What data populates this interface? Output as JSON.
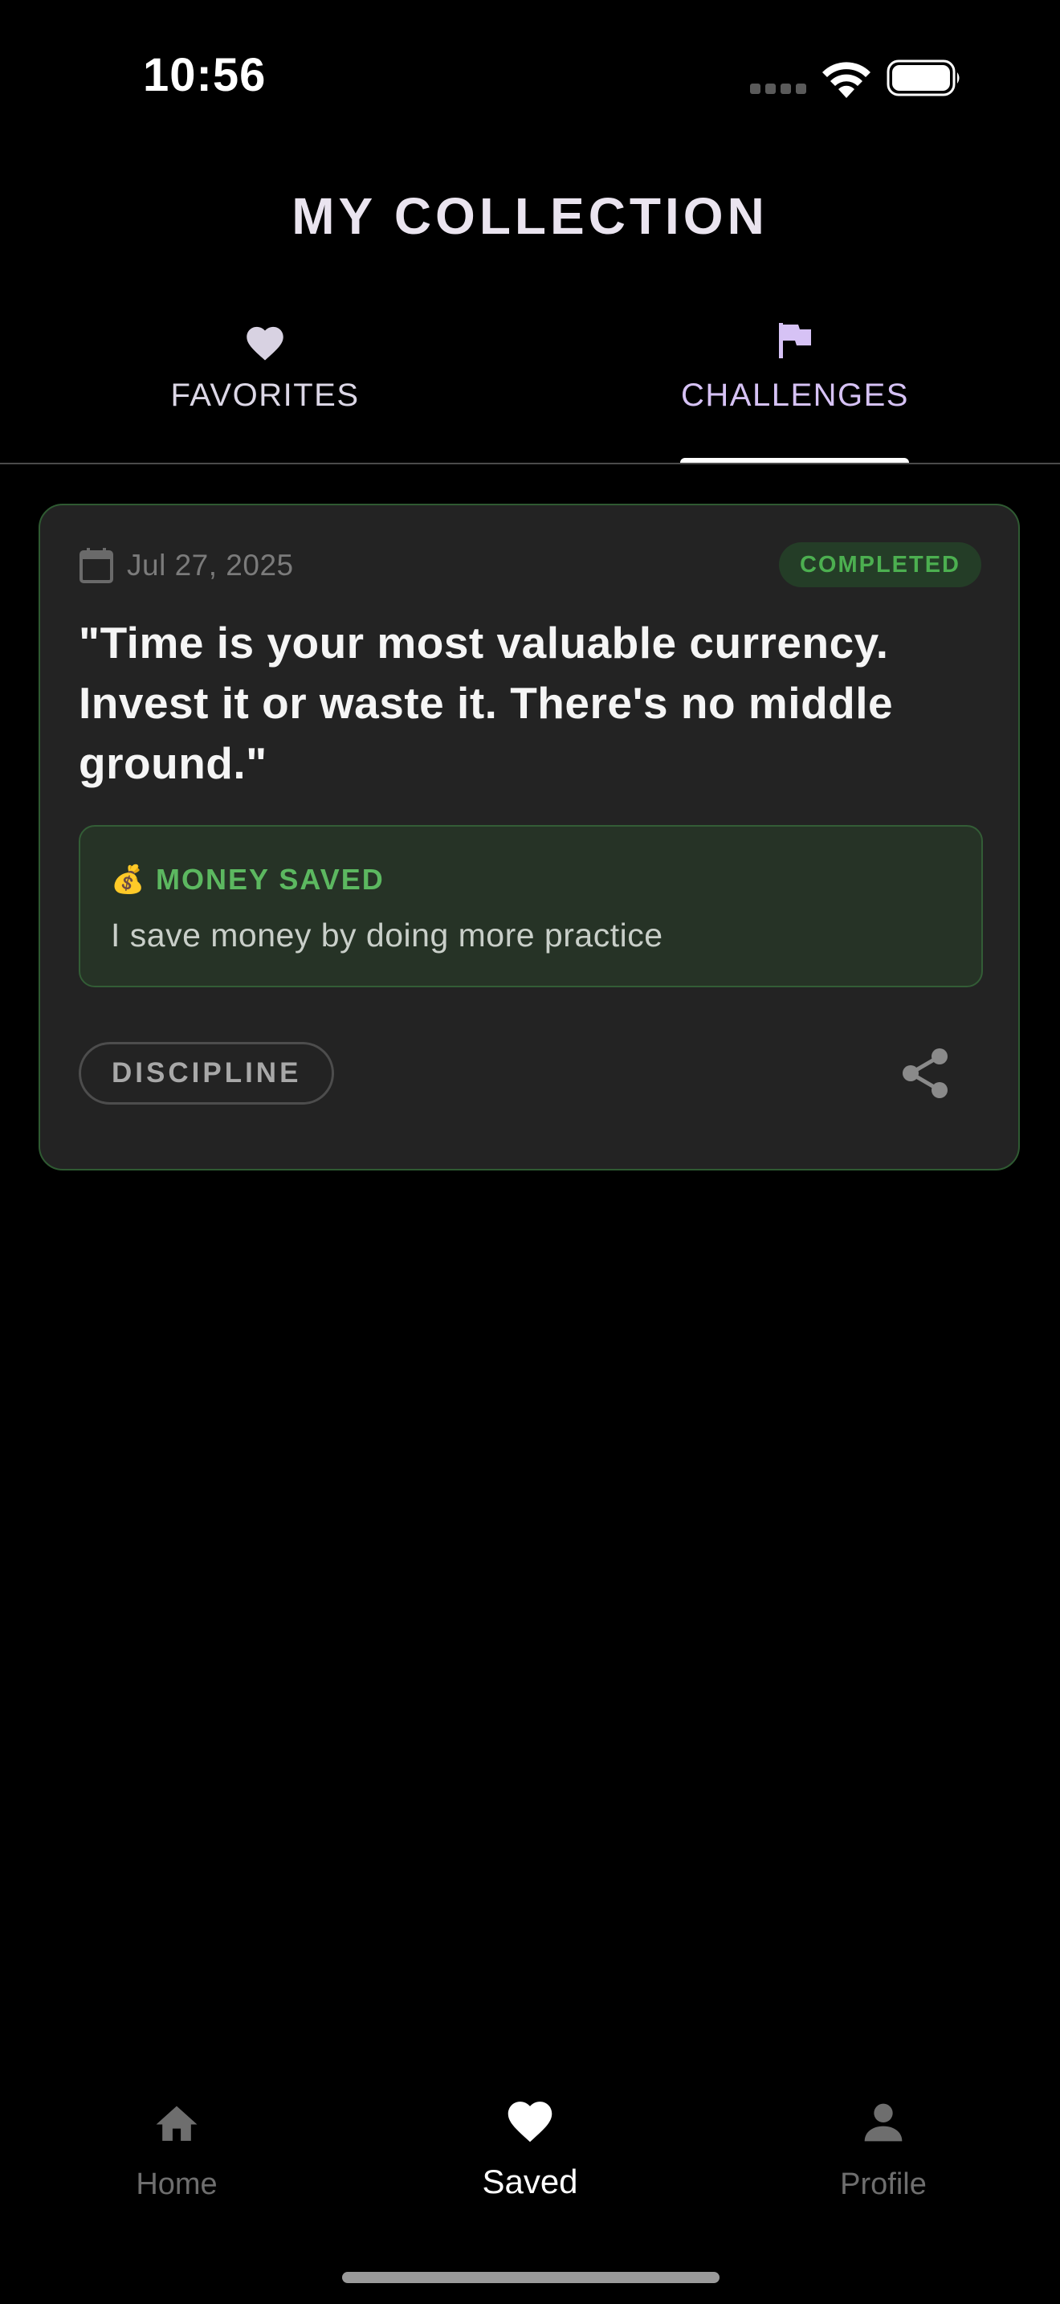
{
  "status_bar": {
    "time": "10:56"
  },
  "page_title": "MY COLLECTION",
  "tabs": [
    {
      "label": "FAVORITES",
      "icon": "heart-icon",
      "active": false
    },
    {
      "label": "CHALLENGES",
      "icon": "flag-icon",
      "active": true
    }
  ],
  "challenge_card": {
    "date": "Jul 27, 2025",
    "status": "COMPLETED",
    "quote": "\"Time is your most valuable currency. Invest it or waste it. There's no middle ground.\"",
    "money_saved": {
      "icon": "💰",
      "title": "MONEY SAVED",
      "text": "I save money by doing more practice"
    },
    "tag": "DISCIPLINE",
    "share_icon": "share-icon"
  },
  "bottom_nav": [
    {
      "label": "Home",
      "icon": "home-icon",
      "active": false
    },
    {
      "label": "Saved",
      "icon": "heart-icon",
      "active": true
    },
    {
      "label": "Profile",
      "icon": "person-icon",
      "active": false
    }
  ],
  "colors": {
    "background": "#000000",
    "card_background": "#232323",
    "card_border": "#2f5a32",
    "accent_green": "#4caf50",
    "accent_purple": "#d6c2f5",
    "inactive_gray": "#6e6e6e"
  }
}
